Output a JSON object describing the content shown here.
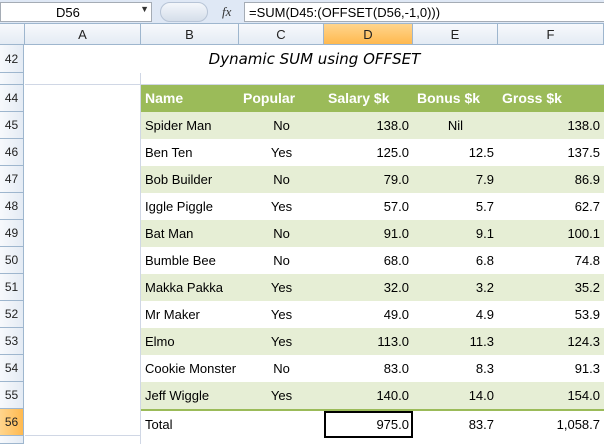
{
  "formula_bar": {
    "name_box": "D56",
    "fx_label": "fx",
    "formula": "=SUM(D45:(OFFSET(D56,-1,0)))"
  },
  "columns": [
    "A",
    "B",
    "C",
    "D",
    "E",
    "F"
  ],
  "rows": [
    "42",
    "",
    "44",
    "45",
    "46",
    "47",
    "48",
    "49",
    "50",
    "51",
    "52",
    "53",
    "54",
    "55",
    "56"
  ],
  "title": "Dynamic SUM using OFFSET",
  "table": {
    "headers": [
      "Name",
      "Popular",
      "Salary $k",
      "Bonus $k",
      "Gross $k"
    ],
    "rows": [
      [
        "Spider Man",
        "No",
        "138.0",
        "Nil",
        "138.0"
      ],
      [
        "Ben Ten",
        "Yes",
        "125.0",
        "12.5",
        "137.5"
      ],
      [
        "Bob Builder",
        "No",
        "79.0",
        "7.9",
        "86.9"
      ],
      [
        "Iggle Piggle",
        "Yes",
        "57.0",
        "5.7",
        "62.7"
      ],
      [
        "Bat Man",
        "No",
        "91.0",
        "9.1",
        "100.1"
      ],
      [
        "Bumble Bee",
        "No",
        "68.0",
        "6.8",
        "74.8"
      ],
      [
        "Makka Pakka",
        "Yes",
        "32.0",
        "3.2",
        "35.2"
      ],
      [
        "Mr Maker",
        "Yes",
        "49.0",
        "4.9",
        "53.9"
      ],
      [
        "Elmo",
        "Yes",
        "113.0",
        "11.3",
        "124.3"
      ],
      [
        "Cookie Monster",
        "No",
        "83.0",
        "8.3",
        "91.3"
      ],
      [
        "Jeff Wiggle",
        "Yes",
        "140.0",
        "14.0",
        "154.0"
      ]
    ],
    "total": [
      "Total",
      "",
      "975.0",
      "83.7",
      "1,058.7"
    ]
  },
  "colors": {
    "header_green": "#9bbb59",
    "band_green": "#e6eed5",
    "selected_header": "#ffb94f"
  }
}
